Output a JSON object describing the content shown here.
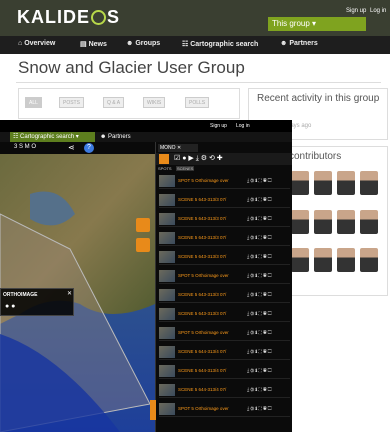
{
  "header": {
    "logo_left": "KALIDE",
    "logo_right": "S",
    "group_select": "This group ▾",
    "signup": "Sign up",
    "login": "Log in"
  },
  "nav": {
    "items": [
      {
        "label": "Overview"
      },
      {
        "label": "News"
      },
      {
        "label": "Groups"
      },
      {
        "label": "Cartographic search"
      },
      {
        "label": "Partners"
      }
    ]
  },
  "page": {
    "title": "Snow and Glacier User Group"
  },
  "actions": [
    "ALL",
    "POSTS",
    "Q & A",
    "WIKIS",
    "POLLS"
  ],
  "recent": {
    "title": "Recent activity in this group",
    "time": "days ago"
  },
  "contributors": {
    "title": "contributors",
    "count": 12
  },
  "app": {
    "top": {
      "signup": "Sign up",
      "login": "Log in"
    },
    "nav": {
      "carto": "Cartographic search",
      "partners": "Partners"
    },
    "tab": "MONO",
    "tabs2": [
      "SPOTS",
      "SCENES"
    ],
    "popup": "ORTHOIMAGE",
    "rows": [
      "SPOT 5 Orthoimage over",
      "SCENE 5 643-313/3 07/",
      "SCENE 5 643-313/3 07/",
      "SCENE 5 643-313/3 07/",
      "SCENE 5 643-313/3 07/",
      "SPOT 5 Orthoimage over",
      "SCENE 5 643-313/3 07/",
      "SCENE 5 643-313/3 07/",
      "SPOT 5 Orthoimage over",
      "SCENE 5 644-313/4 07/",
      "SCENE 5 644-313/4 07/",
      "SCENE 5 644-313/4 07/",
      "SPOT 5 Orthoimage over"
    ]
  }
}
